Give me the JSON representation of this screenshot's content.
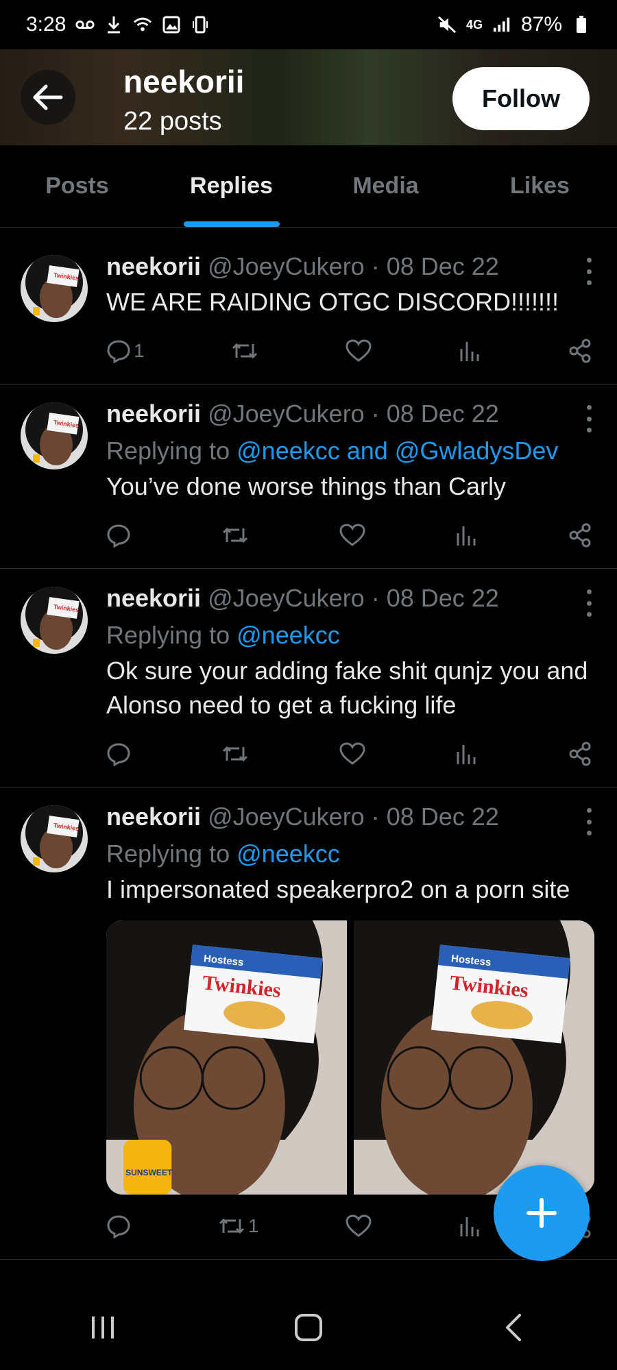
{
  "status_bar": {
    "time": "3:28",
    "left_icons": [
      "voicemail-icon",
      "download-icon",
      "wifi-icon",
      "gallery-icon",
      "vibrate-icon"
    ],
    "right_icons": [
      "mute-icon",
      "4g-lte-icon",
      "signal-icon"
    ],
    "network": "4G",
    "battery": "87%"
  },
  "header": {
    "display_name": "neekorii",
    "post_count": "22 posts",
    "follow_label": "Follow"
  },
  "tabs": [
    {
      "label": "Posts"
    },
    {
      "label": "Replies"
    },
    {
      "label": "Media"
    },
    {
      "label": "Likes"
    }
  ],
  "tweets": [
    {
      "name": "neekorii",
      "meta": "@JoeyCukero · 08 Dec 22",
      "text": "WE ARE RAIDING OTGC DISCORD!!!!!!!",
      "reply_count": "1"
    },
    {
      "name": "neekorii",
      "meta": "@JoeyCukero · 08 Dec 22",
      "replying_prefix": "Replying to",
      "replying_to": "@neekcc and @GwladysDev",
      "text": "You’ve done worse things than Carly"
    },
    {
      "name": "neekorii",
      "meta": "@JoeyCukero · 08 Dec 22",
      "replying_prefix": "Replying to",
      "replying_to": "@neekcc",
      "text": "Ok sure your adding fake shit qunjz you and Alonso need to get a fucking life"
    },
    {
      "name": "neekorii",
      "meta": "@JoeyCukero · 08 Dec 22",
      "replying_prefix": "Replying to",
      "replying_to": "@neekcc",
      "text": "I impersonated speakerpro2 on a porn site",
      "retweet_count": "1",
      "media_labels": {
        "brand": "Hostess",
        "product": "Twinkies",
        "drink": "SUNSWEET"
      }
    }
  ],
  "colors": {
    "accent": "#1d9bf0",
    "background": "#000000",
    "text_primary": "#e7e9ea",
    "text_secondary": "#71767b"
  }
}
